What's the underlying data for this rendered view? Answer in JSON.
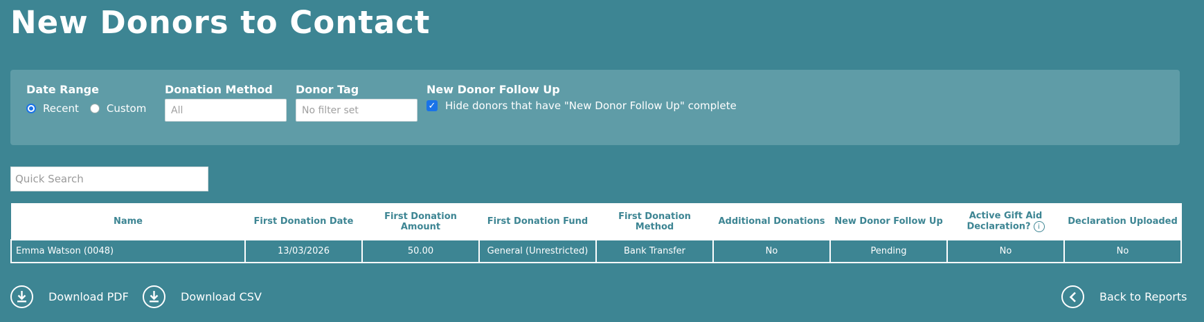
{
  "page": {
    "title": "New Donors to Contact"
  },
  "filters": {
    "date_range": {
      "label": "Date Range",
      "options": [
        "Recent",
        "Custom"
      ],
      "selected": "Recent"
    },
    "donation_method": {
      "label": "Donation Method",
      "placeholder": "All"
    },
    "donor_tag": {
      "label": "Donor Tag",
      "placeholder": "No filter set"
    },
    "follow_up": {
      "label": "New Donor Follow Up",
      "checkbox_label": "Hide donors that have \"New Donor Follow Up\" complete",
      "checked": true
    }
  },
  "search": {
    "placeholder": "Quick Search"
  },
  "table": {
    "columns": [
      "Name",
      "First Donation Date",
      "First Donation Amount",
      "First Donation Fund",
      "First Donation Method",
      "Additional Donations",
      "New Donor Follow Up",
      "Active Gift Aid Declaration?",
      "Declaration Uploaded"
    ],
    "rows": [
      [
        "Emma Watson (0048)",
        "13/03/2026",
        "50.00",
        "General (Unrestricted)",
        "Bank Transfer",
        "No",
        "Pending",
        "No",
        "No"
      ]
    ]
  },
  "actions": {
    "download_pdf": "Download PDF",
    "download_csv": "Download CSV",
    "back": "Back to Reports"
  },
  "colors": {
    "background": "#3d8593",
    "panel": "#5f9ca7",
    "accent": "#1a73e8"
  },
  "icons": {
    "download": "download-circle-icon",
    "back": "chevron-left-circle-icon",
    "info": "info-icon"
  }
}
